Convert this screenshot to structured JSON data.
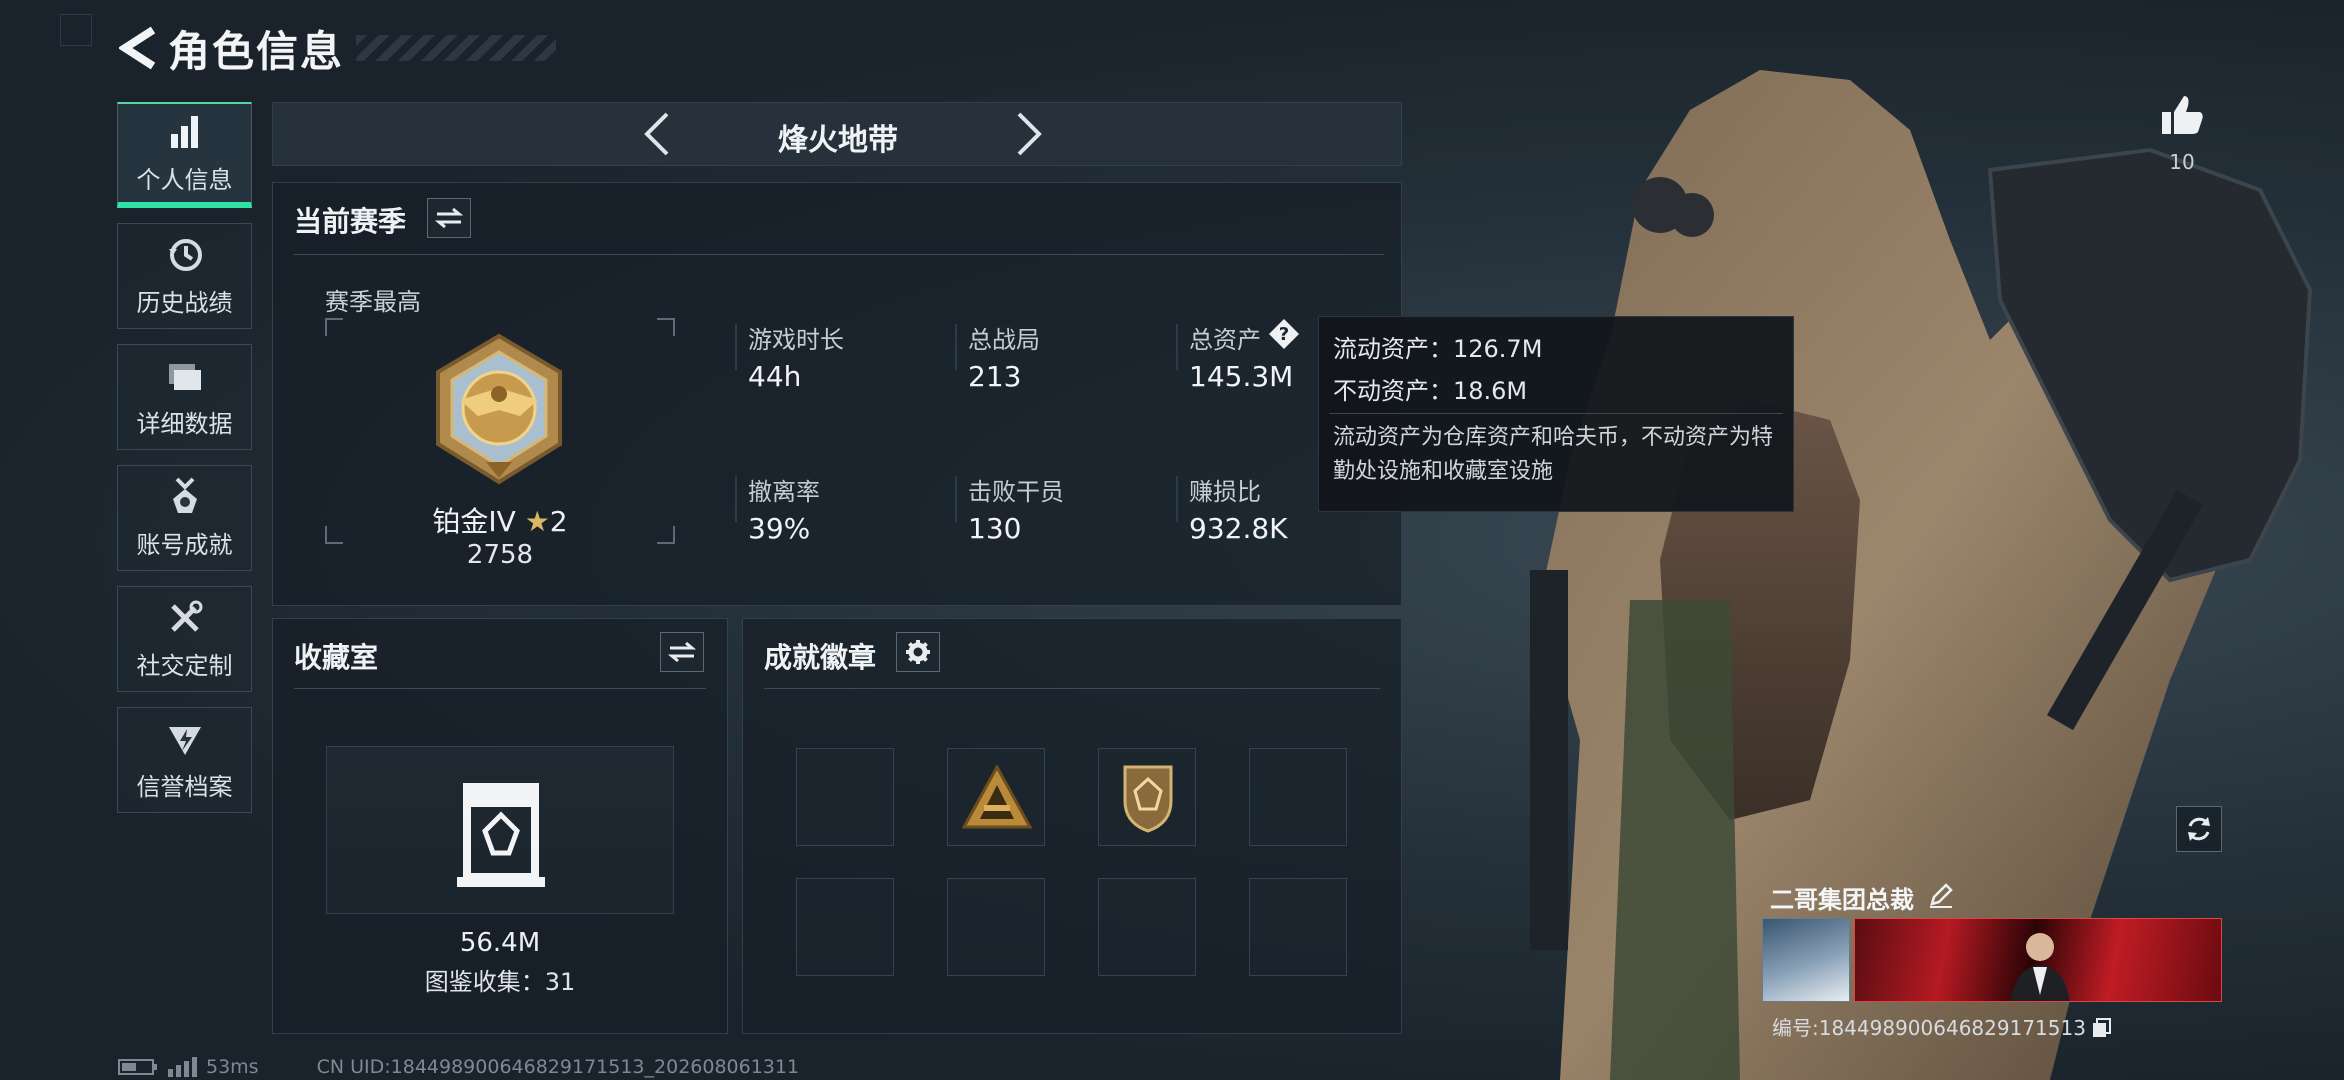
{
  "header": {
    "title": "角色信息"
  },
  "sidebar": {
    "items": [
      {
        "label": "个人信息",
        "icon": "bar-chart-icon",
        "active": true
      },
      {
        "label": "历史战绩",
        "icon": "clock-icon"
      },
      {
        "label": "详细数据",
        "icon": "folder-icon"
      },
      {
        "label": "账号成就",
        "icon": "medal-icon"
      },
      {
        "label": "社交定制",
        "icon": "wrench-screwdriver-icon"
      },
      {
        "label": "信誉档案",
        "icon": "shield-bolt-icon"
      }
    ]
  },
  "mode": {
    "title": "烽火地带"
  },
  "season": {
    "title": "当前赛季",
    "best_label": "赛季最高",
    "rank_name": "铂金IV",
    "rank_stars": "2",
    "rank_points": "2758",
    "stats": [
      {
        "label": "游戏时长",
        "value": "44h"
      },
      {
        "label": "总战局",
        "value": "213"
      },
      {
        "label": "总资产",
        "value": "145.3M"
      },
      {
        "label": "撤离率",
        "value": "39%"
      },
      {
        "label": "击败干员",
        "value": "130"
      },
      {
        "label": "赚损比",
        "value": "932.8K"
      }
    ]
  },
  "tooltip": {
    "liquid": "流动资产：126.7M",
    "fixed": "不动资产：18.6M",
    "description": "流动资产为仓库资产和哈夫币，不动资产为特勤处设施和收藏室设施"
  },
  "collection": {
    "title": "收藏室",
    "value": "56.4M",
    "codex": "图鉴收集：31"
  },
  "badges": {
    "title": "成就徽章"
  },
  "likes": {
    "count": "10"
  },
  "player": {
    "name": "二哥集团总裁",
    "uid_label": "编号:18449890064682917151​3"
  },
  "status": {
    "ping": "53ms",
    "uid": "CN UID:18449890064682917151​3_202608061311"
  },
  "colors": {
    "accent": "#2fe3a5",
    "background": "#1a2530"
  }
}
